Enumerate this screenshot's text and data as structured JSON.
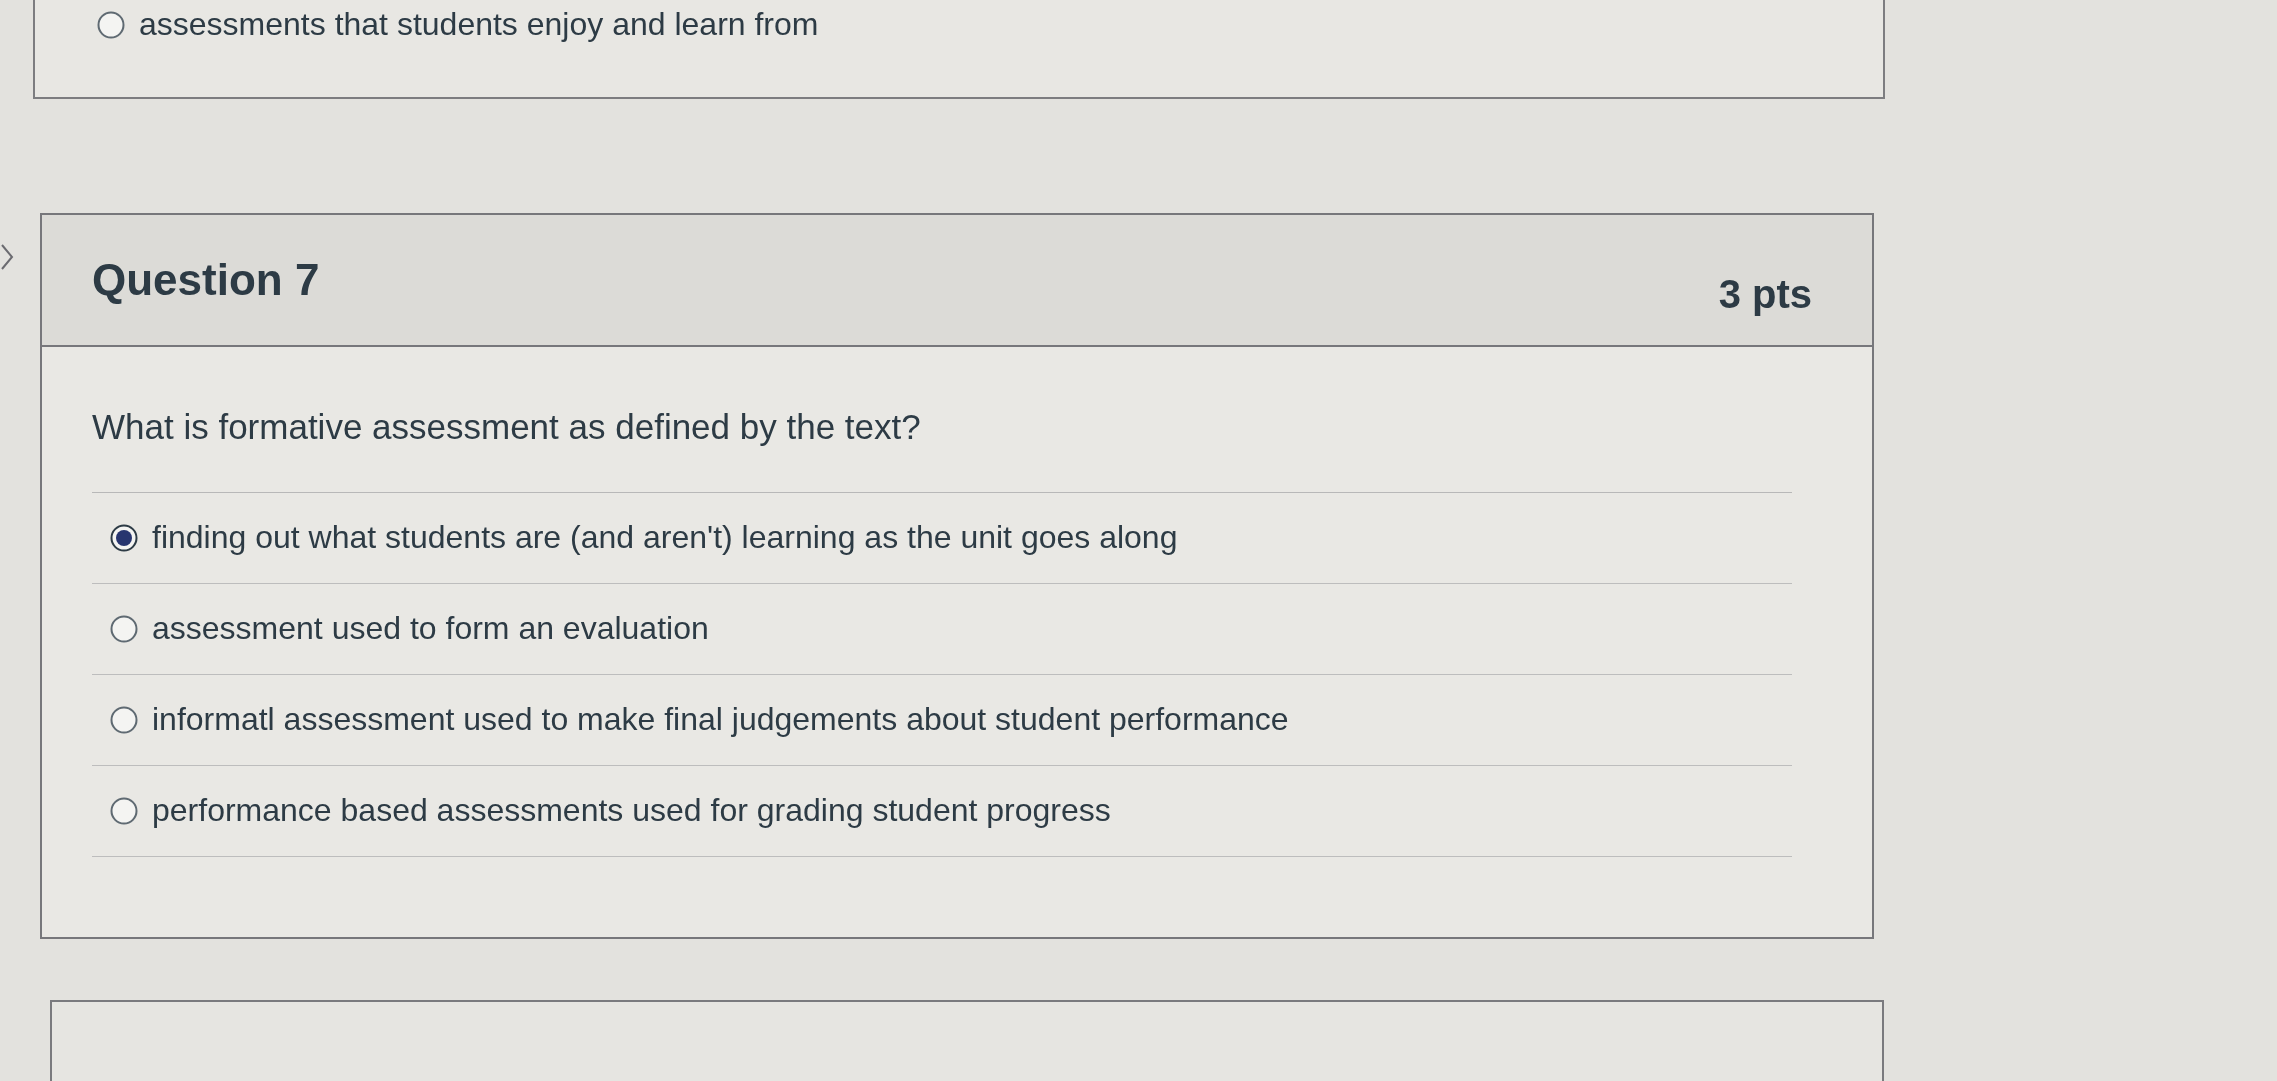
{
  "previous_question": {
    "answer": {
      "text": "assessments that students enjoy and learn from",
      "selected": false
    }
  },
  "question": {
    "title": "Question 7",
    "points": "3 pts",
    "prompt": "What is formative assessment as defined by the text?",
    "answers": [
      {
        "text": "finding out what students are (and aren't) learning as the unit goes along",
        "selected": true
      },
      {
        "text": "assessment used to form an evaluation",
        "selected": false
      },
      {
        "text": "informatl assessment used to make final judgements about student performance",
        "selected": false
      },
      {
        "text": "performance based assessments used for grading student progress",
        "selected": false
      }
    ]
  }
}
